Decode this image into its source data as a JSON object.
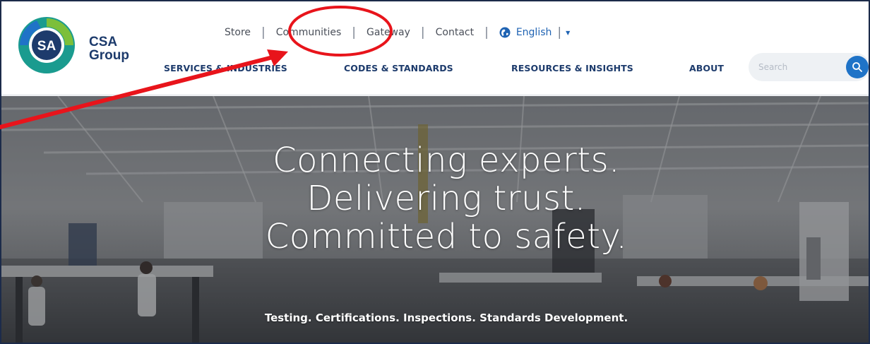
{
  "brand": {
    "name_line1": "CSA",
    "name_line2": "Group",
    "logo_mark_text": "SA"
  },
  "utility_nav": {
    "links": [
      "Store",
      "Communities",
      "Gateway",
      "Contact"
    ],
    "language": "English"
  },
  "main_nav": {
    "items": [
      "SERVICES & INDUSTRIES",
      "CODES & STANDARDS",
      "RESOURCES & INSIGHTS",
      "ABOUT"
    ]
  },
  "search": {
    "placeholder": "Search"
  },
  "hero": {
    "title_lines": [
      "Connecting experts.",
      "Delivering trust.",
      "Committed to safety."
    ],
    "subtitle": "Testing. Certifications. Inspections. Standards Development."
  },
  "annotation": {
    "color": "#e8141b",
    "circled_item": "Communities"
  },
  "icons": {
    "search": "search-icon",
    "language": "globe-icon",
    "language_dropdown": "caret-down-icon"
  },
  "colors": {
    "brand_navy": "#1d3b6c",
    "link_blue": "#1f63b3",
    "search_button": "#1f73c7"
  }
}
